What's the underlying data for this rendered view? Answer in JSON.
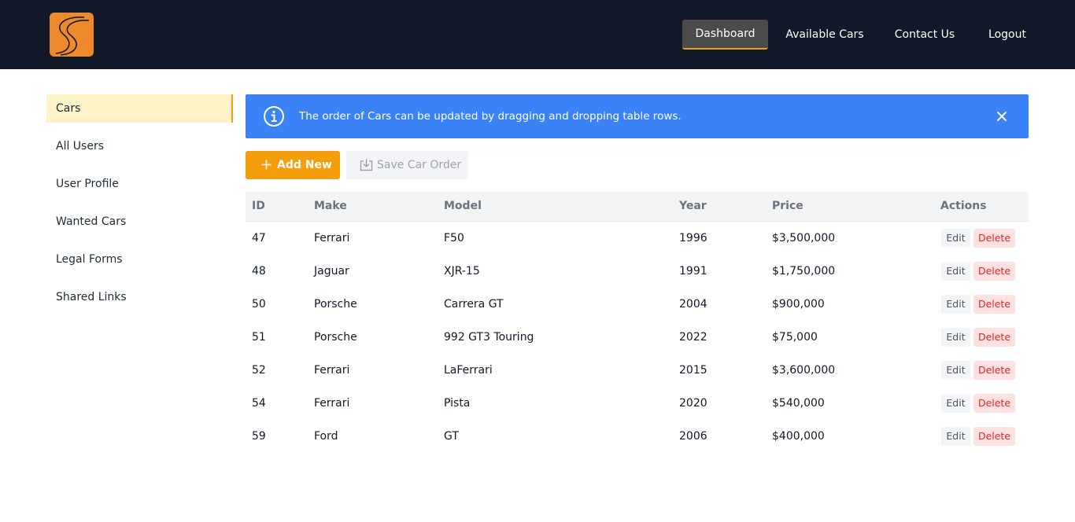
{
  "header": {
    "nav": [
      {
        "label": "Dashboard",
        "active": true
      },
      {
        "label": "Available Cars",
        "active": false
      },
      {
        "label": "Contact Us",
        "active": false
      },
      {
        "label": "Logout",
        "active": false
      }
    ]
  },
  "sidebar": {
    "items": [
      {
        "label": "Cars",
        "active": true
      },
      {
        "label": "All Users",
        "active": false
      },
      {
        "label": "User Profile",
        "active": false
      },
      {
        "label": "Wanted Cars",
        "active": false
      },
      {
        "label": "Legal Forms",
        "active": false
      },
      {
        "label": "Shared Links",
        "active": false
      }
    ]
  },
  "alert": {
    "message": "The order of Cars can be updated by dragging and dropping table rows.",
    "icon": "info-icon",
    "close_icon": "close-icon"
  },
  "toolbar": {
    "add_label": "Add New",
    "save_label": "Save Car Order"
  },
  "table": {
    "headers": {
      "id": "ID",
      "make": "Make",
      "model": "Model",
      "year": "Year",
      "price": "Price",
      "actions": "Actions"
    },
    "edit_label": "Edit",
    "delete_label": "Delete",
    "rows": [
      {
        "id": "47",
        "make": "Ferrari",
        "model": "F50",
        "year": "1996",
        "price": "$3,500,000"
      },
      {
        "id": "48",
        "make": "Jaguar",
        "model": "XJR-15",
        "year": "1991",
        "price": "$1,750,000"
      },
      {
        "id": "50",
        "make": "Porsche",
        "model": "Carrera GT",
        "year": "2004",
        "price": "$900,000"
      },
      {
        "id": "51",
        "make": "Porsche",
        "model": "992 GT3 Touring",
        "year": "2022",
        "price": "$75,000"
      },
      {
        "id": "52",
        "make": "Ferrari",
        "model": "LaFerrari",
        "year": "2015",
        "price": "$3,600,000"
      },
      {
        "id": "54",
        "make": "Ferrari",
        "model": "Pista",
        "year": "2020",
        "price": "$540,000"
      },
      {
        "id": "59",
        "make": "Ford",
        "model": "GT",
        "year": "2006",
        "price": "$400,000"
      }
    ]
  },
  "colors": {
    "header_bg": "#111827",
    "accent": "#f59e0b",
    "alert_bg": "#3b82f6",
    "logo": "#ee8a2c",
    "delete_bg": "#fee2e2",
    "delete_text": "#dc2626"
  }
}
